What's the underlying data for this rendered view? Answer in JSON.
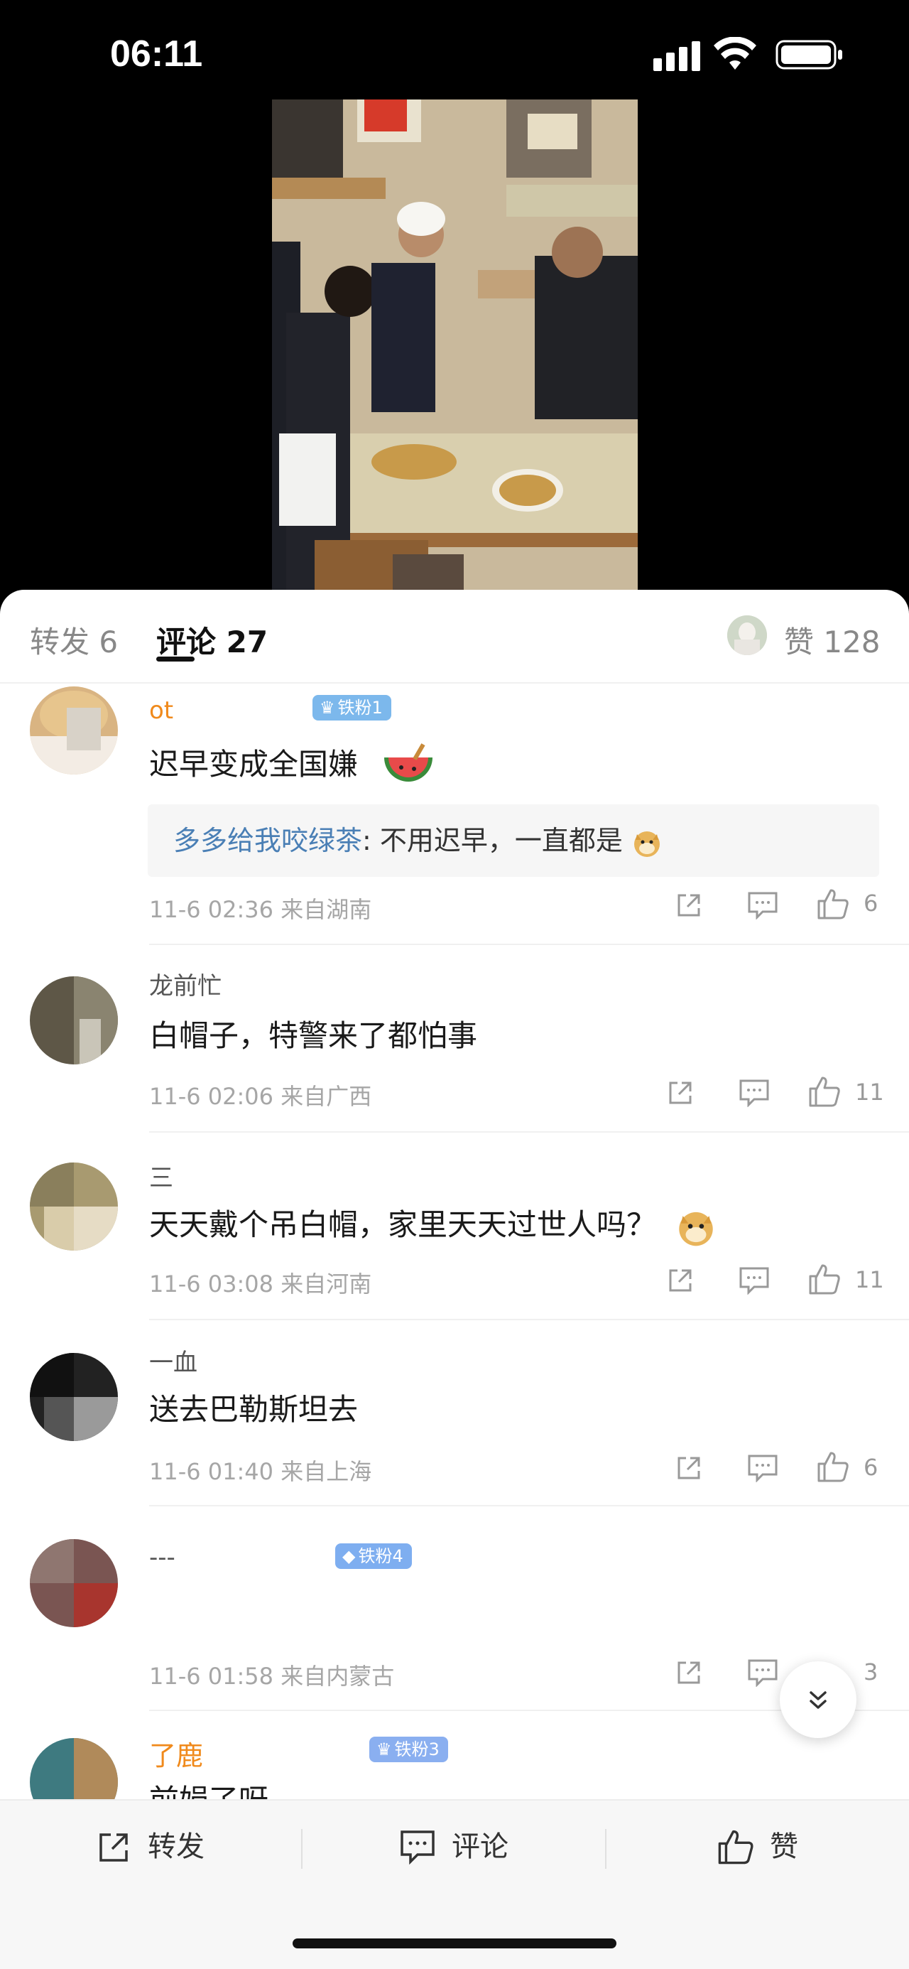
{
  "status": {
    "time": "06:11"
  },
  "tabs": {
    "repost": "转发 6",
    "comment": "评论 27",
    "likes": "赞 128"
  },
  "comments": [
    {
      "name": "ot",
      "badge": "铁粉1",
      "text": "迟早变成全国嫌",
      "reply_who": "多多给我咬绿茶",
      "reply_text": ": 不用迟早，一直都是",
      "meta": "11-6 02:36  来自湖南",
      "likes": "6"
    },
    {
      "name": "龙前忙",
      "text": "白帽子，特警来了都怕事",
      "meta": "11-6 02:06  来自广西",
      "likes": "11"
    },
    {
      "name": "三",
      "text": "天天戴个吊白帽，家里天天过世人吗？",
      "meta": "11-6 03:08  来自河南",
      "likes": "11"
    },
    {
      "name": "一血",
      "text": "送去巴勒斯坦去",
      "meta": "11-6 01:40  来自上海",
      "likes": "6"
    },
    {
      "name": "---",
      "badge": "铁粉4",
      "text": "",
      "meta": "11-6 01:58  来自内蒙古",
      "likes": "3"
    },
    {
      "name": "了鹿",
      "badge": "铁粉3",
      "text": "前娟了呀"
    }
  ],
  "bottom_bar": {
    "repost": "转发",
    "comment": "评论",
    "like": "赞"
  },
  "colors": {
    "link": "#4a7fb5",
    "meta": "#a6a6a6",
    "badge": "#7cb8ec"
  },
  "icons": [
    "signal-icon",
    "wifi-icon",
    "battery-icon",
    "share-icon",
    "comment-icon",
    "thumbs-up-icon",
    "chevron-down-icon",
    "watermelon-emoji",
    "doge-emoji"
  ]
}
